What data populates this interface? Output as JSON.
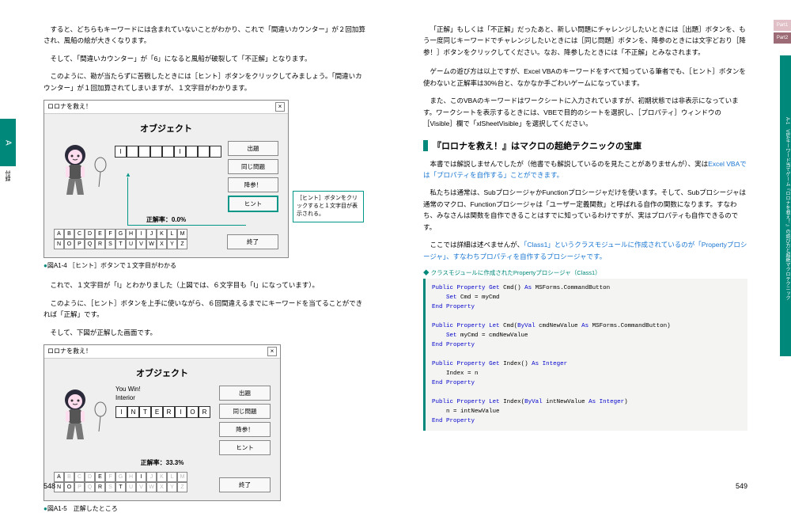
{
  "leftPage": {
    "sideTab": "A",
    "sideLabel": "付録",
    "para1": "すると、どちらもキーワードには含まれていないことがわかり、これで「間違いカウンター」が２回加算され、風船の絵が大きくなります。",
    "para2": "そして、「間違いカウンター」が「6」になると風船が破裂して「不正解」となります。",
    "para3": "このように、勘が当たらずに苦戦したときには［ヒント］ボタンをクリックしてみましょう。「間違いカウンター」が１回加算されてしまいますが、１文字目がわかります。",
    "win1": {
      "title": "ロロナを救え！",
      "header": "オブジェクト",
      "btn1": "出題",
      "btn2": "同じ問題",
      "btn3": "降参！",
      "btn4": "ヒント",
      "accuracy": "正解率：0.0%",
      "endBtn": "終了",
      "letters": [
        "I",
        "",
        "",
        "",
        "",
        "I",
        "",
        "",
        ""
      ],
      "alphabet": [
        "A",
        "B",
        "C",
        "D",
        "E",
        "F",
        "G",
        "H",
        "I",
        "J",
        "K",
        "L",
        "M",
        "N",
        "O",
        "P",
        "Q",
        "R",
        "S",
        "T",
        "U",
        "V",
        "W",
        "X",
        "Y",
        "Z"
      ]
    },
    "callout": "［ヒント］ボタンをクリックすると１文字目が表示される。",
    "cap1": "図A1-4 ［ヒント］ボタンで１文字目がわかる",
    "para4": "これで、１文字目が「I」とわかりました（上図では、６文字目も「I」になっています）。",
    "para5": "このように、［ヒント］ボタンを上手に使いながら、６回間違えるまでにキーワードを当てることができれば「正解」です。",
    "para6": "そして、下図が正解した画面です。",
    "win2": {
      "title": "ロロナを救え！",
      "header": "オブジェクト",
      "status1": "You Win!",
      "status2": "Interior",
      "btn1": "出題",
      "btn2": "同じ問題",
      "btn3": "降参！",
      "btn4": "ヒント",
      "accuracy": "正解率：33.3%",
      "endBtn": "終了",
      "letters": [
        "I",
        "N",
        "T",
        "E",
        "R",
        "I",
        "O",
        "R"
      ],
      "alphaDim": [
        "B",
        "C",
        "D",
        "F",
        "G",
        "H",
        "J",
        "K",
        "L",
        "M",
        "P",
        "Q",
        "S",
        "U",
        "V",
        "W",
        "X",
        "Y",
        "Z"
      ]
    },
    "cap2": "図A1-5　正解したところ",
    "pageNum": "548"
  },
  "rightPage": {
    "tab1": "Part1",
    "tab2": "Part2",
    "sideStrip": "A-1　VBAキーワード当てゲーム『ロロナを救え！』の遊び方と超絶マクロテクニック",
    "para1": "「正解」もしくは「不正解」だったあと、新しい問題にチャレンジしたいときには［出題］ボタンを、もう一度同じキーワードでチャレンジしたいときには［同じ問題］ボタンを、降参のときには文字どおり［降参！］ボタンをクリックしてください。なお、降参したときには「不正解」とみなされます。",
    "para2": "ゲームの遊び方は以上ですが、Excel VBAのキーワードをすべて知っている筆者でも、［ヒント］ボタンを使わないと正解率は30%台と、なかなか手ごわいゲームになっています。",
    "para3": "また、このVBAのキーワードはワークシートに入力されていますが、初期状態では非表示になっています。ワークシートを表示するときには、VBEで目的のシートを選択し、［プロパティ］ウィンドウの［Visible］欄で「xlSheetVisible」を選択してください。",
    "secTitle": "『ロロナを救え！』はマクロの超絶テクニックの宝庫",
    "para4a": "本書では解説しませんでしたが（他書でも解説しているのを見たことがありませんが）、実は",
    "para4b": "Excel VBAでは「プロパティを自作する」ことができます。",
    "para5": "私たちは通常は、SubプロシージャかFunctionプロシージャだけを使います。そして、Subプロシージャは通常のマクロ、Functionプロシージャは「ユーザー定義関数」と呼ばれる自作の関数になります。すなわち、みなさんは関数を自作できることはすでに知っているわけですが、実はプロパティも自作できるのです。",
    "para6a": "ここでは詳細は述べませんが、",
    "para6b": "「Class1」というクラスモジュールに作成されているのが「Propertyプロシージャ」、すなわちプロパティを自作するプロシージャです。",
    "codeHead": "クラスモジュールに作成されたPropertyプロシージャ（Class1）",
    "code": "Public Property Get Cmd() As MSForms.CommandButton\n    Set Cmd = myCmd\nEnd Property\n\nPublic Property Let Cmd(ByVal cmdNewValue As MSForms.CommandButton)\n    Set myCmd = cmdNewValue\nEnd Property\n\nPublic Property Get Index() As Integer\n    Index = n\nEnd Property\n\nPublic Property Let Index(ByVal intNewValue As Integer)\n    n = intNewValue\nEnd Property",
    "pageNum": "549"
  }
}
